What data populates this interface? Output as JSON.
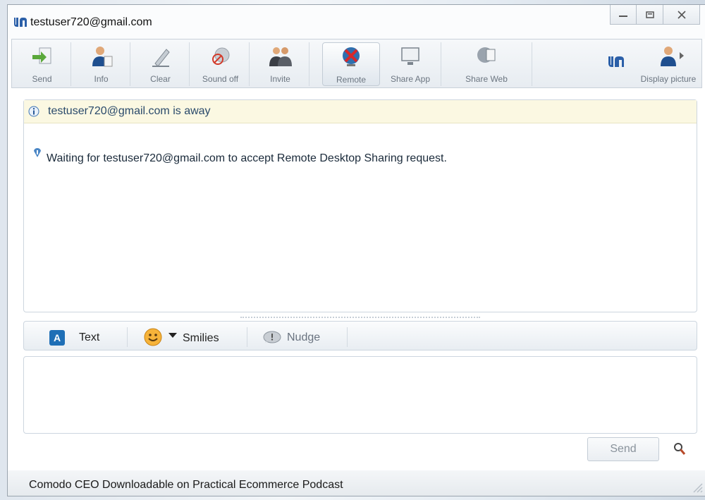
{
  "window": {
    "title": "testuser720@gmail.com",
    "controls": [
      "minimize",
      "restore",
      "close"
    ]
  },
  "toolbar": {
    "items": [
      {
        "label": "Send",
        "icon": "send-file-icon"
      },
      {
        "label": "Info",
        "icon": "contact-info-icon"
      },
      {
        "label": "Clear",
        "icon": "eraser-icon"
      },
      {
        "label": "Sound off",
        "icon": "sound-off-icon"
      },
      {
        "label": "Invite",
        "icon": "invite-users-icon"
      },
      {
        "label": "Remote",
        "icon": "remote-desktop-icon"
      },
      {
        "label": "Share App",
        "icon": "share-app-icon"
      },
      {
        "label": "Share Web",
        "icon": "share-web-icon"
      }
    ],
    "display_picture_label": "Display picture"
  },
  "chat": {
    "away_notice": "testuser720@gmail.com is away",
    "message": "Waiting for testuser720@gmail.com to accept Remote Desktop Sharing request."
  },
  "format_bar": {
    "text_label": "Text",
    "text_icon_letter": "A",
    "smilies_label": "Smilies",
    "nudge_label": "Nudge"
  },
  "compose": {
    "value": "",
    "send_label": "Send"
  },
  "status_bar": {
    "text": "Comodo CEO Downloadable on Practical Ecommerce Podcast"
  },
  "colors": {
    "accent_blue": "#1f6fb6",
    "away_bar": "#fbf8e2"
  }
}
